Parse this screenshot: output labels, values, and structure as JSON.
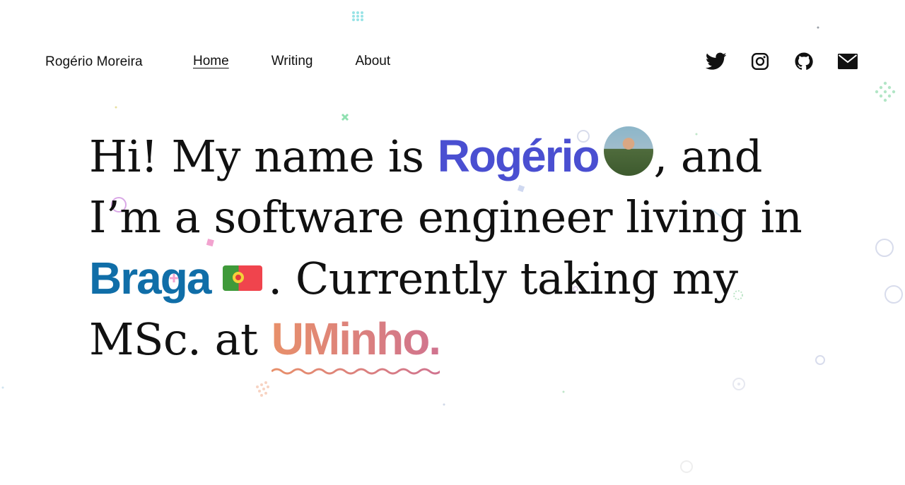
{
  "header": {
    "site_name": "Rogério Moreira",
    "nav": [
      {
        "label": "Home",
        "active": true
      },
      {
        "label": "Writing",
        "active": false
      },
      {
        "label": "About",
        "active": false
      }
    ],
    "social_icons": [
      "twitter-icon",
      "instagram-icon",
      "github-icon",
      "mail-icon"
    ]
  },
  "hero": {
    "part1": "Hi! My name is ",
    "name": "Rogério",
    "part2": ", and",
    "part3": "I’m a software engineer living in",
    "city": "Braga",
    "part4": ". Currently taking my",
    "part5": "MSc. at ",
    "school": "UMinho."
  },
  "colors": {
    "name": "#4a4fd1",
    "city": "#106ea8",
    "school_gradient_start": "#e8906a",
    "school_gradient_end": "#d0738f"
  }
}
